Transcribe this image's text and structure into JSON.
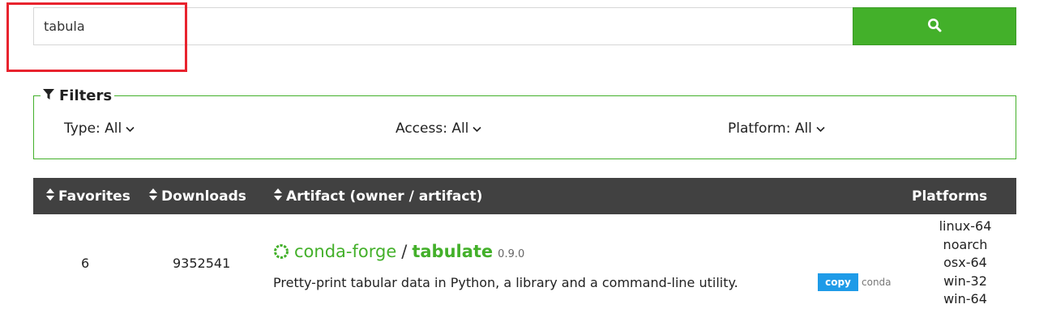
{
  "search": {
    "value": "tabula",
    "button_icon": "search-icon"
  },
  "filters": {
    "legend": "Filters",
    "legend_icon": "filter-icon",
    "type_label": "Type: All",
    "access_label": "Access: All",
    "platform_label": "Platform: All"
  },
  "table": {
    "headers": {
      "favorites": "Favorites",
      "downloads": "Downloads",
      "artifact": "Artifact (owner / artifact)",
      "platforms": "Platforms"
    },
    "rows": [
      {
        "favorites": "6",
        "downloads": "9352541",
        "owner": "conda-forge",
        "separator": "/",
        "artifact": "tabulate",
        "version": "0.9.0",
        "description": "Pretty-print tabular data in Python, a library and a command-line utility.",
        "copy_button": "copy",
        "copy_type": "conda",
        "platforms": [
          "linux-64",
          "noarch",
          "osx-64",
          "win-32",
          "win-64"
        ]
      }
    ]
  },
  "colors": {
    "accent_green": "#43b02a",
    "header_bg": "#414141",
    "copy_blue": "#1e9be8",
    "highlight_red": "#e8232e"
  }
}
